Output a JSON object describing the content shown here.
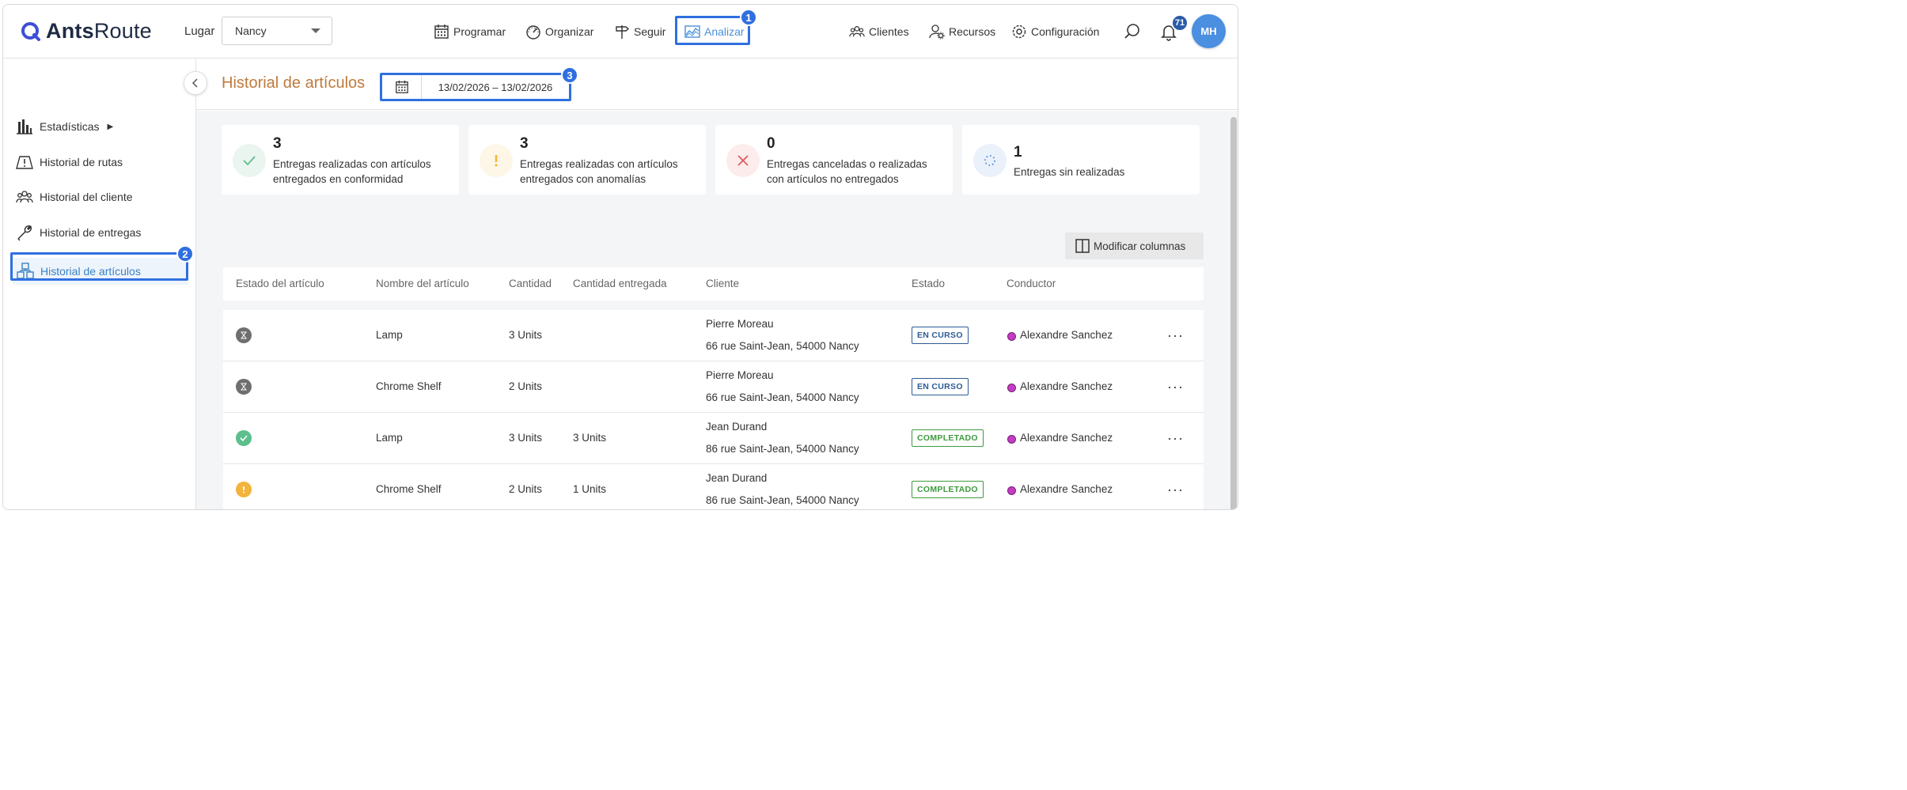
{
  "app": {
    "logo_bold": "Ants",
    "logo_light": "Route"
  },
  "header": {
    "place_label": "Lugar",
    "place_value": "Nancy",
    "nav": {
      "programar": "Programar",
      "organizar": "Organizar",
      "seguir": "Seguir",
      "analizar": "Analizar",
      "clientes": "Clientes",
      "recursos": "Recursos",
      "configuracion": "Configuración"
    },
    "notifications_count": "71",
    "avatar_initials": "MH"
  },
  "annotations": {
    "step1": "1",
    "step2": "2",
    "step3": "3"
  },
  "sidebar": {
    "items": [
      {
        "label": "Estadísticas",
        "arrow": "▶"
      },
      {
        "label": "Historial de rutas"
      },
      {
        "label": "Historial del cliente"
      },
      {
        "label": "Historial de entregas"
      },
      {
        "label": "Historial de artículos"
      }
    ]
  },
  "page": {
    "title": "Historial de artículos",
    "date_range": "13/02/2026 – 13/02/2026"
  },
  "summary_cards": [
    {
      "value": "3",
      "text": "Entregas realizadas con artículos entregados en conformidad"
    },
    {
      "value": "3",
      "text": "Entregas realizadas con artículos entregados con anomalías"
    },
    {
      "value": "0",
      "text": "Entregas canceladas o realizadas con artículos no entregados"
    },
    {
      "value": "1",
      "text": "Entregas sin realizadas"
    }
  ],
  "toolbar": {
    "modify_columns": "Modificar columnas"
  },
  "table": {
    "columns": [
      "Estado del artículo",
      "Nombre del artículo",
      "Cantidad",
      "Cantidad entregada",
      "Cliente",
      "Estado",
      "Conductor"
    ],
    "rows": [
      {
        "status_icon": "hourglass-icon",
        "name": "Lamp",
        "qty": "3 Units",
        "delivered": "",
        "client": "Pierre Moreau",
        "address": "66 rue Saint-Jean, 54000 Nancy",
        "state": "EN CURSO",
        "driver": "Alexandre Sanchez"
      },
      {
        "status_icon": "hourglass-icon",
        "name": "Chrome Shelf",
        "qty": "2 Units",
        "delivered": "",
        "client": "Pierre Moreau",
        "address": "66 rue Saint-Jean, 54000 Nancy",
        "state": "EN CURSO",
        "driver": "Alexandre Sanchez"
      },
      {
        "status_icon": "check-icon",
        "name": "Lamp",
        "qty": "3 Units",
        "delivered": "3 Units",
        "client": "Jean Durand",
        "address": "86 rue Saint-Jean, 54000 Nancy",
        "state": "COMPLETADO",
        "driver": "Alexandre Sanchez"
      },
      {
        "status_icon": "warning-icon",
        "name": "Chrome Shelf",
        "qty": "2 Units",
        "delivered": "1 Units",
        "client": "Jean Durand",
        "address": "86 rue Saint-Jean, 54000 Nancy",
        "state": "COMPLETADO",
        "driver": "Alexandre Sanchez"
      }
    ],
    "more_glyph": "···"
  },
  "colors": {
    "accent": "#4a90d9",
    "highlight": "#2f6fe0",
    "title": "#c07a3c",
    "success": "#5cbf8e",
    "warning": "#f2b43c",
    "danger": "#e05c5c",
    "in_progress_icon": "#6f6f6f",
    "driver": "#c43cc4"
  }
}
